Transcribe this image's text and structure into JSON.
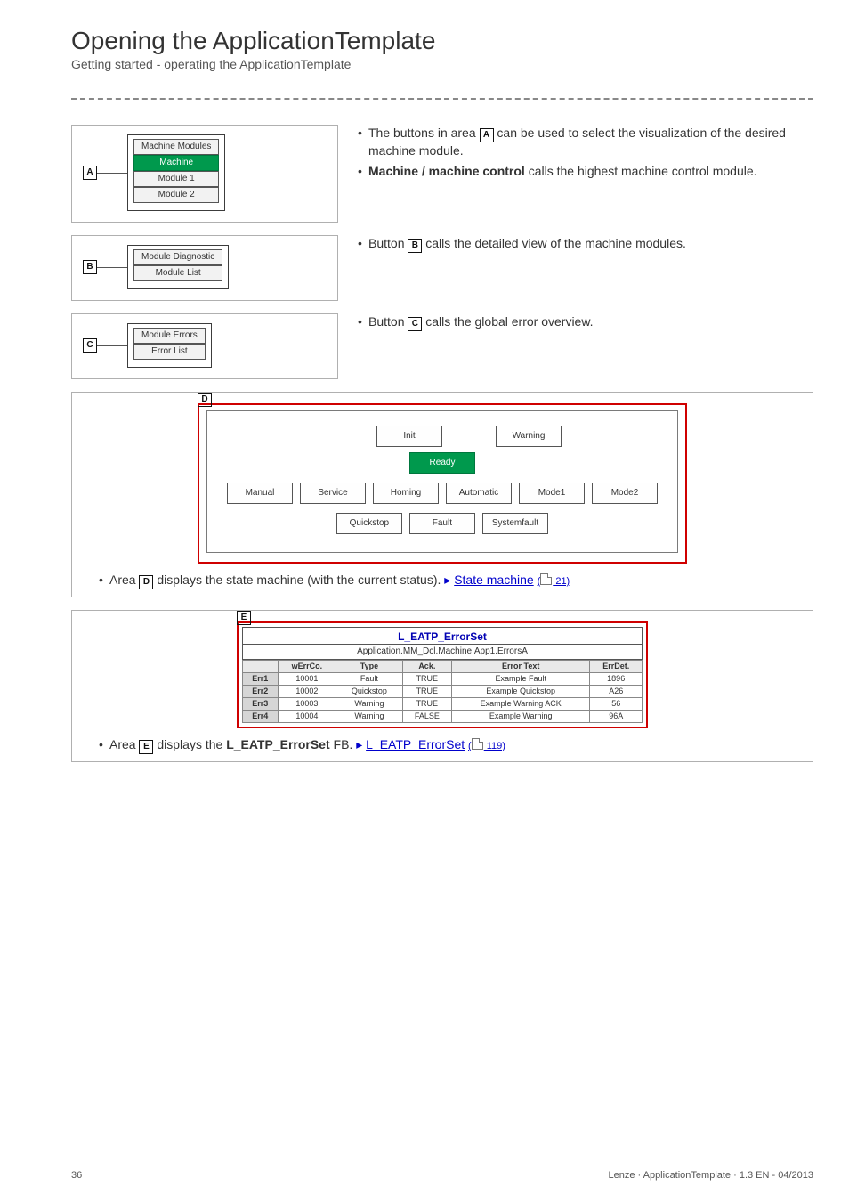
{
  "header": {
    "title": "Opening the ApplicationTemplate",
    "subtitle": "Getting started - operating the ApplicationTemplate"
  },
  "panel_a": {
    "letter": "A",
    "legend": "Machine Modules",
    "buttons": {
      "machine": "Machine",
      "module1": "Module 1",
      "module2": "Module 2"
    },
    "bullets": {
      "b1_pre": "The buttons in area ",
      "b1_post": " can be used to select the visualization of the desired machine module.",
      "b2_bold": "Machine / machine control",
      "b2_tail": " calls the highest machine control module."
    }
  },
  "panel_b": {
    "letter": "B",
    "legend": "Module Diagnostic",
    "button": "Module List",
    "bullet_pre": "Button ",
    "bullet_post": " calls the detailed view of the machine modules."
  },
  "panel_c": {
    "letter": "C",
    "legend": "Module Errors",
    "button": "Error List",
    "bullet_pre": "Button ",
    "bullet_post": " calls the global error overview."
  },
  "panel_d": {
    "letter": "D",
    "states": {
      "init": "Init",
      "warning": "Warning",
      "ready": "Ready",
      "manual": "Manual",
      "service": "Service",
      "homing": "Homing",
      "automatic": "Automatic",
      "mode1": "Mode1",
      "mode2": "Mode2",
      "quickstop": "Quickstop",
      "fault": "Fault",
      "systemfault": "Systemfault"
    },
    "note_pre": "Area ",
    "note_mid": " displays the state machine (with the current status). ",
    "note_link": "State machine",
    "note_pg": " 21)"
  },
  "panel_e": {
    "letter": "E",
    "title": "L_EATP_ErrorSet",
    "path": "Application.MM_Dcl.Machine.App1.ErrorsA",
    "headers": [
      "",
      "wErrCo.",
      "Type",
      "Ack.",
      "Error Text",
      "ErrDet."
    ],
    "rows": [
      {
        "label": "Err1",
        "w": "10001",
        "type": "Fault",
        "ack": "TRUE",
        "txt": "Example Fault",
        "det": "1896"
      },
      {
        "label": "Err2",
        "w": "10002",
        "type": "Quickstop",
        "ack": "TRUE",
        "txt": "Example Quickstop",
        "det": "A26"
      },
      {
        "label": "Err3",
        "w": "10003",
        "type": "Warning",
        "ack": "TRUE",
        "txt": "Example Warning ACK",
        "det": "56"
      },
      {
        "label": "Err4",
        "w": "10004",
        "type": "Warning",
        "ack": "FALSE",
        "txt": "Example Warning",
        "det": "96A"
      }
    ],
    "note_pre": "Area ",
    "note_mid": " displays the ",
    "note_bold": "L_EATP_ErrorSet",
    "note_tail": " FB. ",
    "note_link": "L_EATP_ErrorSet",
    "note_pg": " 119)"
  },
  "footer": {
    "pagenum": "36",
    "right": "Lenze · ApplicationTemplate · 1.3 EN - 04/2013"
  }
}
